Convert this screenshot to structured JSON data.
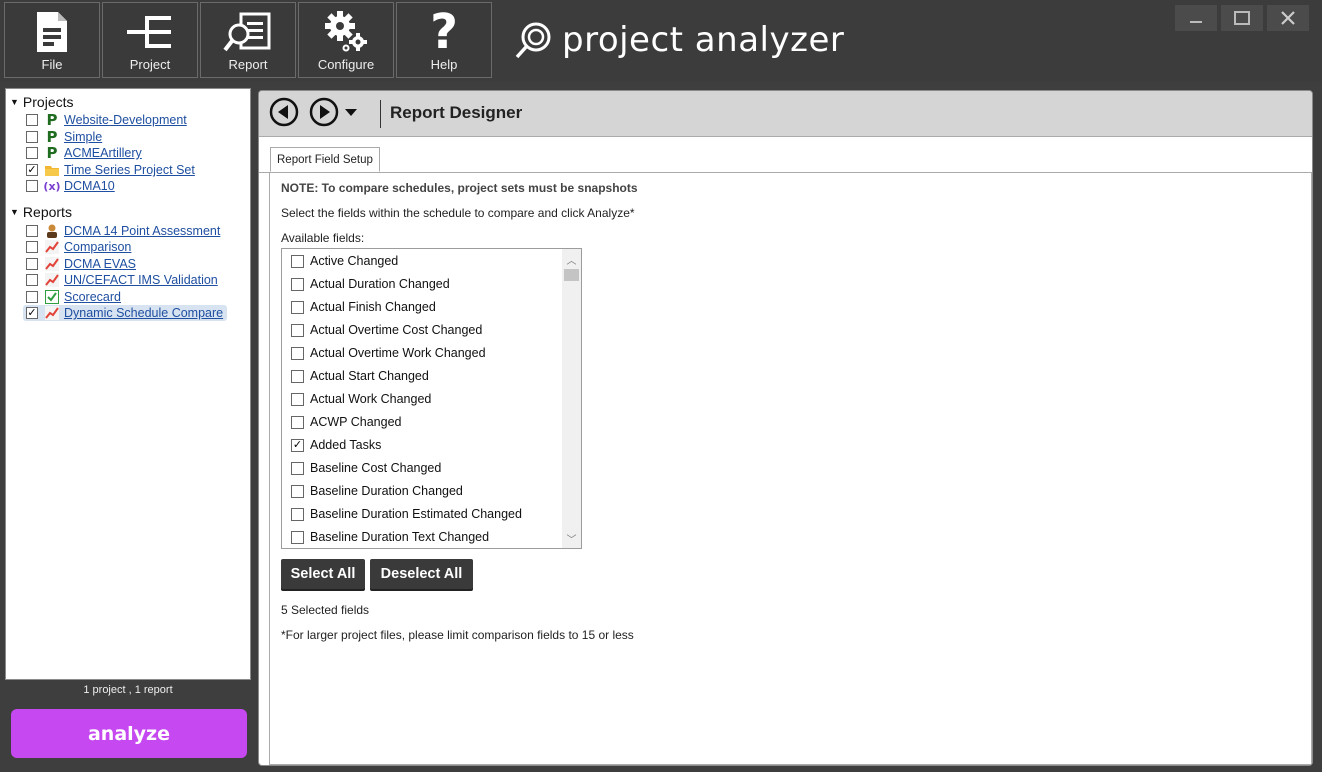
{
  "toolbar": {
    "buttons": [
      {
        "label": "File",
        "icon": "file-icon"
      },
      {
        "label": "Project",
        "icon": "project-tree-icon"
      },
      {
        "label": "Report",
        "icon": "report-magnifier-icon"
      },
      {
        "label": "Configure",
        "icon": "gears-icon"
      },
      {
        "label": "Help",
        "icon": "question-mark-icon"
      }
    ],
    "brand": "project analyzer"
  },
  "window_controls": [
    "minimize",
    "maximize",
    "close"
  ],
  "tree": {
    "projects_heading": "Projects",
    "projects": [
      {
        "label": "Website-Development",
        "checked": false,
        "icon": "project-p-icon"
      },
      {
        "label": "Simple",
        "checked": false,
        "icon": "project-p-icon"
      },
      {
        "label": "ACMEArtillery",
        "checked": false,
        "icon": "project-p-icon"
      },
      {
        "label": "Time Series Project Set",
        "checked": true,
        "icon": "folder-icon"
      },
      {
        "label": "DCMA10",
        "checked": false,
        "icon": "variable-x-icon"
      }
    ],
    "reports_heading": "Reports",
    "reports": [
      {
        "label": "DCMA 14 Point Assessment",
        "checked": false,
        "icon": "person-icon"
      },
      {
        "label": "Comparison",
        "checked": false,
        "icon": "chart-icon"
      },
      {
        "label": "DCMA EVAS",
        "checked": false,
        "icon": "chart-icon"
      },
      {
        "label": "UN/CEFACT IMS Validation",
        "checked": false,
        "icon": "chart-icon"
      },
      {
        "label": "Scorecard",
        "checked": false,
        "icon": "scorecard-icon"
      },
      {
        "label": "Dynamic Schedule Compare",
        "checked": true,
        "icon": "chart-icon",
        "selected": true
      }
    ]
  },
  "summary": "1 project , 1 report",
  "analyze_label": "analyze",
  "header": {
    "title": "Report Designer"
  },
  "tab": "Report Field Setup",
  "note": "NOTE: To compare schedules, project sets must be snapshots",
  "instructions": "Select the fields within the schedule to compare and click Analyze*",
  "available_label": "Available fields:",
  "fields": [
    {
      "label": "Active Changed",
      "checked": false
    },
    {
      "label": "Actual Duration Changed",
      "checked": false
    },
    {
      "label": "Actual Finish Changed",
      "checked": false
    },
    {
      "label": "Actual Overtime Cost Changed",
      "checked": false
    },
    {
      "label": "Actual Overtime Work Changed",
      "checked": false
    },
    {
      "label": "Actual Start Changed",
      "checked": false
    },
    {
      "label": "Actual Work Changed",
      "checked": false
    },
    {
      "label": "ACWP Changed",
      "checked": false
    },
    {
      "label": "Added Tasks",
      "checked": true
    },
    {
      "label": "Baseline Cost Changed",
      "checked": false
    },
    {
      "label": "Baseline Duration Changed",
      "checked": false
    },
    {
      "label": "Baseline Duration Estimated Changed",
      "checked": false
    },
    {
      "label": "Baseline Duration Text Changed",
      "checked": false
    }
  ],
  "buttons": {
    "select_all": "Select All",
    "deselect_all": "Deselect All"
  },
  "selected_count": "5  Selected fields",
  "footnote": "*For larger project files, please limit comparison fields to 15 or less",
  "colors": {
    "analyze": "#c648f0",
    "toolbar": "#3c3c3c",
    "link": "#1f4fa0"
  }
}
